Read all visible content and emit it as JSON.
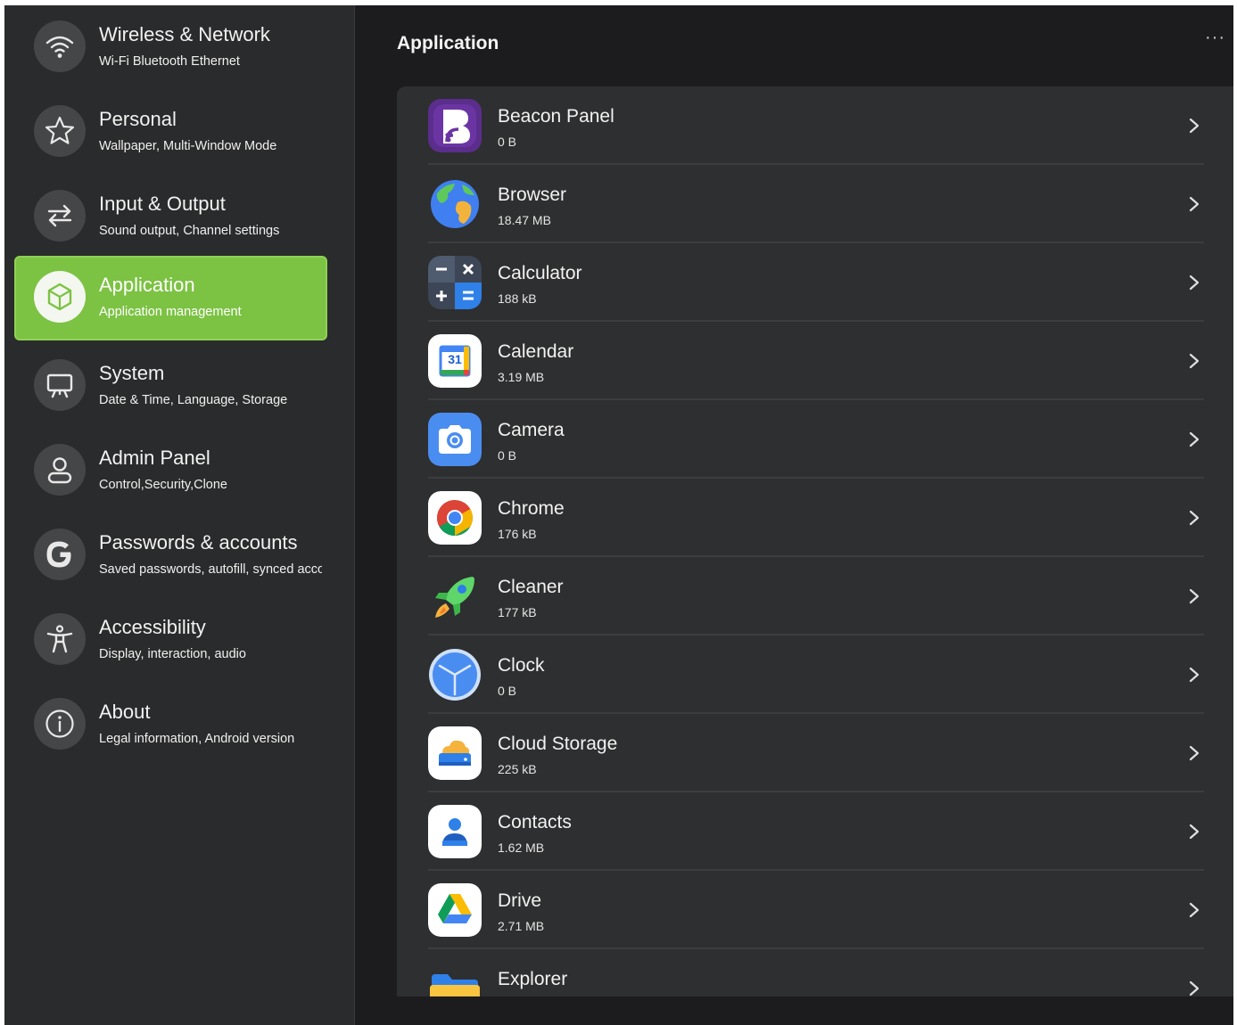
{
  "sidebar": {
    "items": [
      {
        "title": "Wireless & Network",
        "subtitle": "Wi-Fi Bluetooth Ethernet",
        "icon": "wifi-icon"
      },
      {
        "title": "Personal",
        "subtitle": "Wallpaper, Multi-Window Mode",
        "icon": "star-icon"
      },
      {
        "title": "Input & Output",
        "subtitle": "Sound output, Channel settings",
        "icon": "swap-arrows-icon"
      },
      {
        "title": "Application",
        "subtitle": "Application management",
        "icon": "cube-icon",
        "active": true
      },
      {
        "title": "System",
        "subtitle": "Date & Time, Language, Storage",
        "icon": "presentation-board-icon"
      },
      {
        "title": "Admin Panel",
        "subtitle": "Control,Security,Clone",
        "icon": "person-icon"
      },
      {
        "title": "Passwords & accounts",
        "subtitle": "Saved passwords, autofill, synced accounts",
        "icon": "google-g-icon"
      },
      {
        "title": "Accessibility",
        "subtitle": "Display, interaction, audio",
        "icon": "accessibility-person-icon"
      },
      {
        "title": "About",
        "subtitle": "Legal information, Android version",
        "icon": "info-icon"
      }
    ]
  },
  "main": {
    "title": "Application",
    "more_label": "···",
    "apps": [
      {
        "name": "Beacon Panel",
        "size": "0 B",
        "icon": "beacon-panel-icon"
      },
      {
        "name": "Browser",
        "size": "18.47 MB",
        "icon": "globe-icon"
      },
      {
        "name": "Calculator",
        "size": "188 kB",
        "icon": "calculator-icon"
      },
      {
        "name": "Calendar",
        "size": "3.19 MB",
        "icon": "calendar-icon",
        "calendar_day": "31"
      },
      {
        "name": "Camera",
        "size": "0 B",
        "icon": "camera-icon"
      },
      {
        "name": "Chrome",
        "size": "176 kB",
        "icon": "chrome-icon"
      },
      {
        "name": "Cleaner",
        "size": "177 kB",
        "icon": "rocket-icon"
      },
      {
        "name": "Clock",
        "size": "0 B",
        "icon": "clock-icon"
      },
      {
        "name": "Cloud Storage",
        "size": "225 kB",
        "icon": "cloud-drive-icon"
      },
      {
        "name": "Contacts",
        "size": "1.62 MB",
        "icon": "contacts-icon"
      },
      {
        "name": "Drive",
        "size": "2.71 MB",
        "icon": "google-drive-icon"
      },
      {
        "name": "Explorer",
        "size": "",
        "icon": "folder-icon"
      }
    ]
  },
  "colors": {
    "accent": "#7cc243",
    "sidebar_bg": "#2a2b2c",
    "panel_bg": "#2e2f30",
    "page_bg": "#1c1c1e"
  }
}
